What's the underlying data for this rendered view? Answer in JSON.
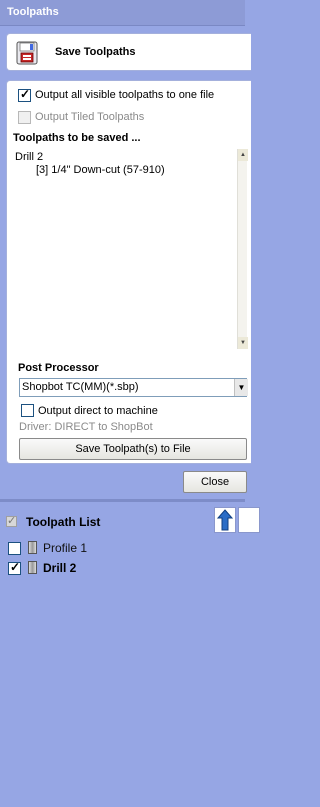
{
  "window": {
    "title": "Toolpaths"
  },
  "header": {
    "title": "Save Toolpaths",
    "icon": "save-toolpaths-icon"
  },
  "options": {
    "output_all_label": "Output all visible toolpaths to one file",
    "output_all_checked": true,
    "output_tiled_label": "Output Tiled Toolpaths",
    "output_tiled_checked": false
  },
  "saved_section": {
    "heading": "Toolpaths to be saved ...",
    "items": [
      {
        "line1": "Drill 2",
        "line2": "[3] 1/4\"  Down-cut (57-910)"
      }
    ]
  },
  "post_processor": {
    "heading": "Post Processor",
    "selected": "Shopbot TC(MM)(*.sbp)",
    "output_direct_label": "Output direct to machine",
    "output_direct_checked": false,
    "driver_text": "Driver: DIRECT to ShopBot",
    "save_button": "Save Toolpath(s) to File"
  },
  "close_button": "Close",
  "toolpath_list": {
    "title": "Toolpath List",
    "header_checked": true,
    "items": [
      {
        "label": "Profile 1",
        "checked": false,
        "bold": false
      },
      {
        "label": "Drill 2",
        "checked": true,
        "bold": true
      }
    ]
  },
  "colors": {
    "background": "#96a6e4",
    "titlebar": "#8d9bd6",
    "arrow": "#2a6cc6"
  }
}
